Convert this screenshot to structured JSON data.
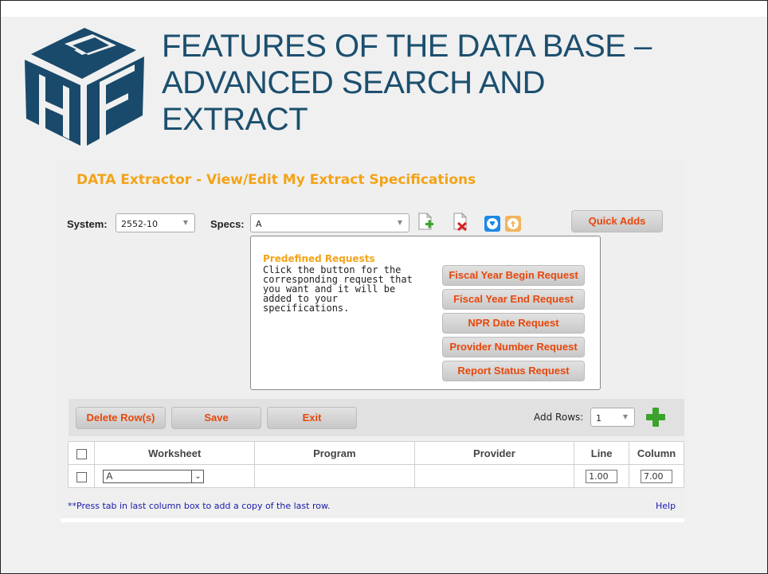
{
  "slide": {
    "title_lines": [
      "FEATURES OF THE DATA BASE –",
      "ADVANCED SEARCH AND",
      "EXTRACT"
    ],
    "logo": {
      "name": "hfp-cube-logo",
      "color": "#1a4a6b"
    }
  },
  "extractor": {
    "heading": "DATA Extractor - View/Edit My Extract Specifications",
    "system_label": "System:",
    "system_value": "2552-10",
    "specs_label": "Specs:",
    "specs_value": "A",
    "icons": [
      "add-spec-icon",
      "delete-spec-icon",
      "download-icon",
      "upload-icon"
    ],
    "quick_adds_label": "Quick Adds"
  },
  "predefined": {
    "title": "Predefined Requests",
    "description": "Click the button for the corresponding request that you want and it will be added to your specifications.",
    "buttons": [
      "Fiscal Year Begin Request",
      "Fiscal Year End Request",
      "NPR Date Request",
      "Provider Number Request",
      "Report Status Request"
    ]
  },
  "toolbar": {
    "delete_label": "Delete Row(s)",
    "save_label": "Save",
    "exit_label": "Exit",
    "add_rows_label": "Add Rows:",
    "add_rows_value": "1"
  },
  "table": {
    "columns": [
      "Worksheet",
      "Program",
      "Provider",
      "Line",
      "Column"
    ],
    "rows": [
      {
        "worksheet": "A",
        "program": "",
        "provider": "",
        "line": "1.00",
        "column": "7.00"
      }
    ]
  },
  "footer": {
    "note": "**Press tab in last column box to add a copy of the last row.",
    "help": "Help"
  },
  "colors": {
    "title": "#1c4f6e",
    "heading": "#f3a317",
    "button_text": "#e8470b",
    "link": "#1a1aa8"
  }
}
